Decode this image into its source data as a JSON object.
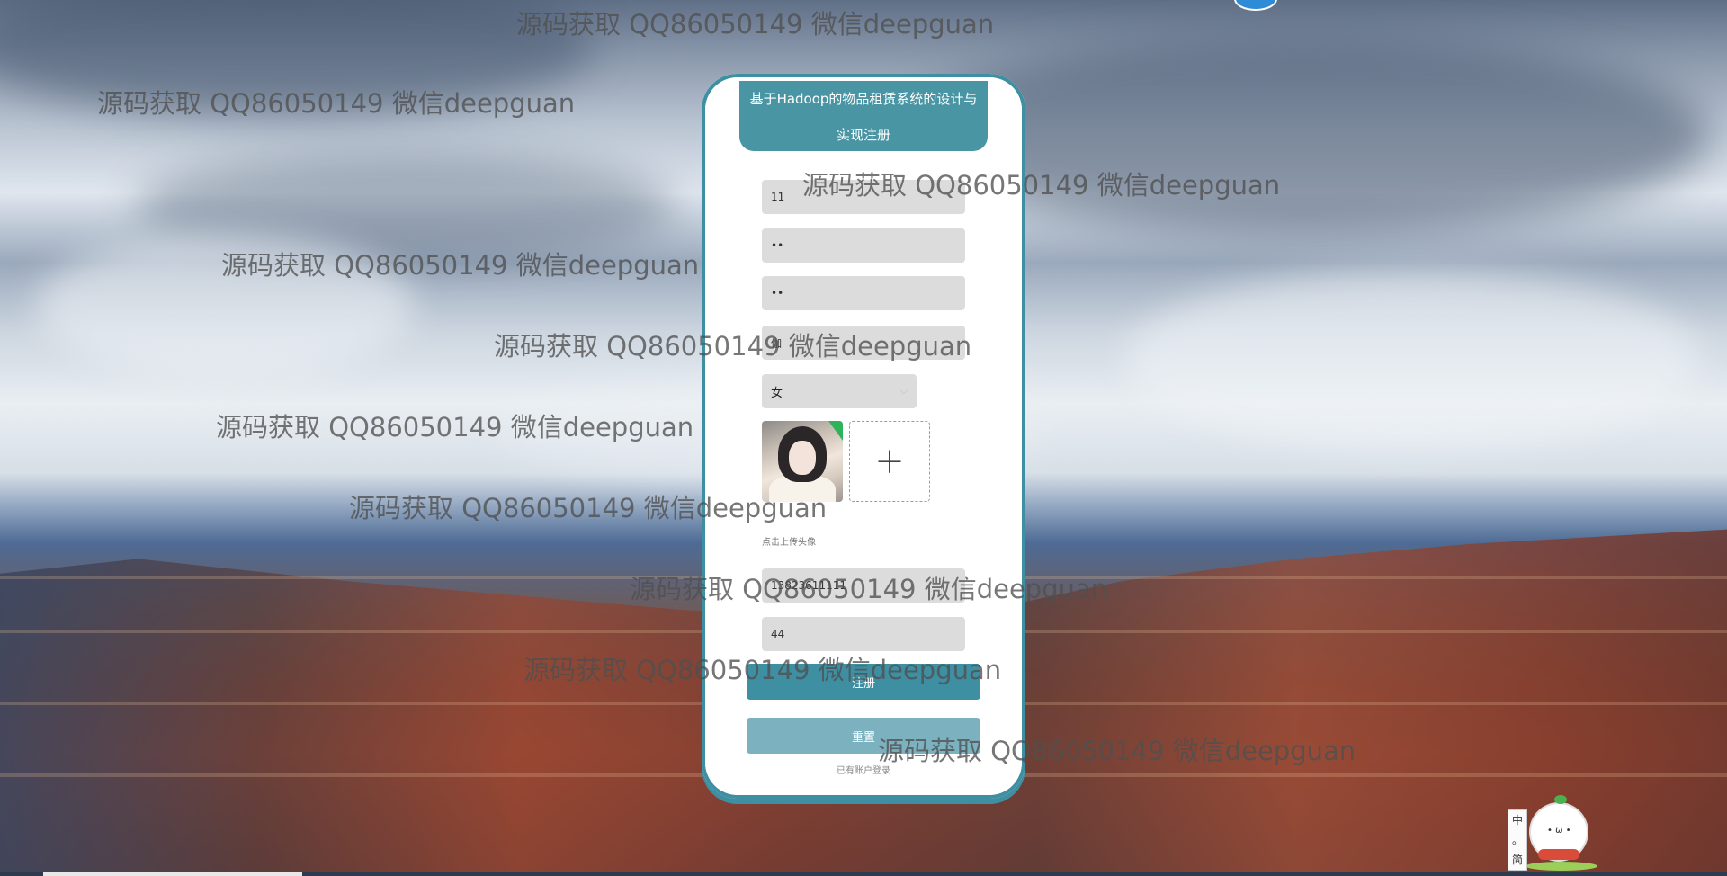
{
  "form": {
    "title": "基于Hadoop的物品租赁系统的设计与实现注册",
    "fields": {
      "account": "11",
      "password": "••",
      "confirm_password": "••",
      "name": "伽",
      "gender": "女",
      "phone": "13823611111",
      "id_card": "44"
    },
    "upload_hint": "点击上传头像",
    "register_label": "注册",
    "reset_label": "重置",
    "login_link": "已有账户登录"
  },
  "watermark": "源码获取 QQ86050149 微信deepguan",
  "mascot": {
    "sign_chars": [
      "中",
      "。",
      "简"
    ]
  },
  "colors": {
    "accent": "#3f8fa2",
    "accent_light": "#7cb1bf",
    "field_bg": "#dcdcdc"
  },
  "icons": {
    "upload": "plus-icon",
    "select_arrow": "chevron-down-icon"
  }
}
